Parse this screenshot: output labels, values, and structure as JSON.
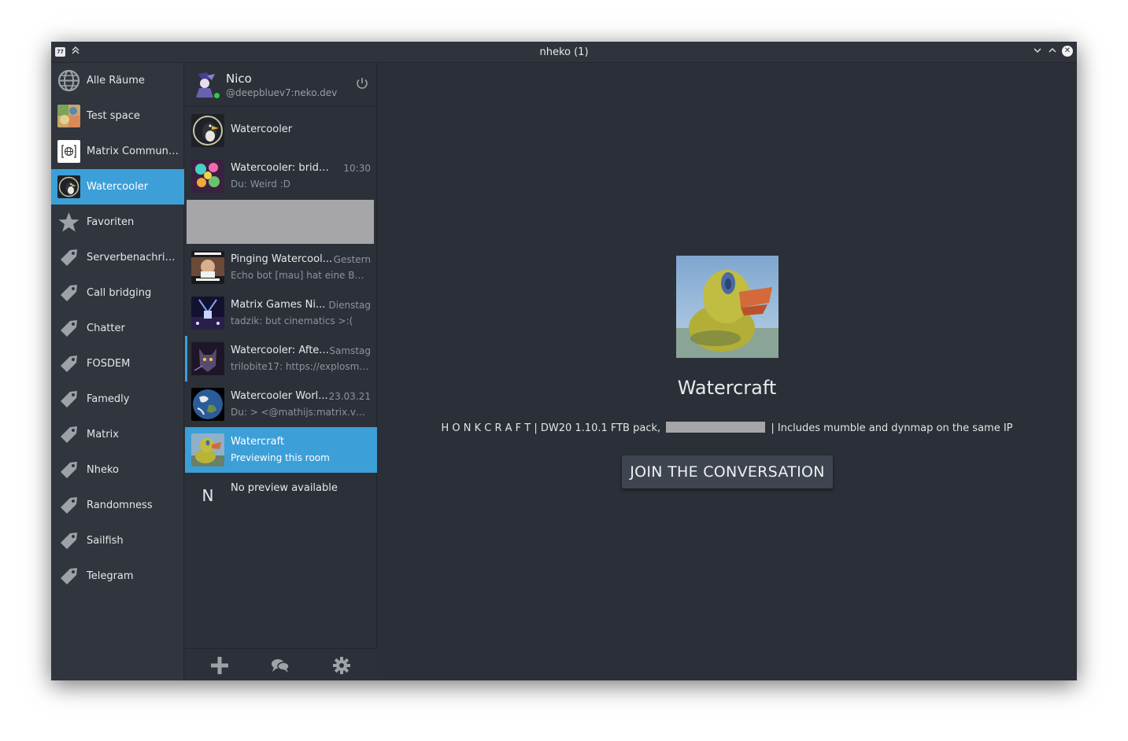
{
  "window": {
    "title": "nheko (1)",
    "app_icon_text": "77"
  },
  "communities": [
    {
      "label": "Alle Räume",
      "icon": "globe-icon"
    },
    {
      "label": "Test space",
      "icon": "avatar-image"
    },
    {
      "label": "Matrix Community",
      "icon": "matrix-logo"
    },
    {
      "label": "Watercooler",
      "icon": "avatar-image",
      "active": true
    },
    {
      "label": "Favoriten",
      "icon": "star-icon"
    },
    {
      "label": "Serverbenachrichtigungen",
      "icon": "tag-icon"
    },
    {
      "label": "Call bridging",
      "icon": "tag-icon"
    },
    {
      "label": "Chatter",
      "icon": "tag-icon"
    },
    {
      "label": "FOSDEM",
      "icon": "tag-icon"
    },
    {
      "label": "Famedly",
      "icon": "tag-icon"
    },
    {
      "label": "Matrix",
      "icon": "tag-icon"
    },
    {
      "label": "Nheko",
      "icon": "tag-icon"
    },
    {
      "label": "Randomness",
      "icon": "tag-icon"
    },
    {
      "label": "Sailfish",
      "icon": "tag-icon"
    },
    {
      "label": "Telegram",
      "icon": "tag-icon"
    }
  ],
  "user": {
    "name": "Nico",
    "id": "@deepbluev7:neko.dev"
  },
  "rooms": [
    {
      "name": "Watercooler",
      "time": "",
      "preview": ""
    },
    {
      "name": "Watercooler: bridge...",
      "time": "10:30",
      "preview": "Du: Weird :D"
    },
    {
      "name": "Pinging Watercool...",
      "time": "Gestern",
      "preview": "Echo bot [mau] hat eine Ben..."
    },
    {
      "name": "Matrix Games Ni...",
      "time": "Dienstag",
      "preview": "tadzik: but cinematics >:("
    },
    {
      "name": "Watercooler: Afte...",
      "time": "Samstag",
      "preview": "trilobite17: https://explosm...."
    },
    {
      "name": "Watercooler Worl...",
      "time": "23.03.21",
      "preview": "Du: > <@mathijs:matrix.vgor..."
    },
    {
      "name": "Watercraft",
      "time": "",
      "preview": "Previewing this room"
    },
    {
      "name": "No preview available",
      "time": "",
      "preview": "",
      "letter": "N"
    }
  ],
  "preview": {
    "room_name": "Watercraft",
    "topic_before": "H O N K C R A F T | DW20 1.10.1 FTB pack,",
    "topic_after": "| Includes mumble and dynmap on the same IP",
    "join_label": "JOIN THE CONVERSATION"
  },
  "colors": {
    "accent": "#3c9fd8",
    "background": "#2a2e36",
    "presence_online": "#2ecc40"
  }
}
